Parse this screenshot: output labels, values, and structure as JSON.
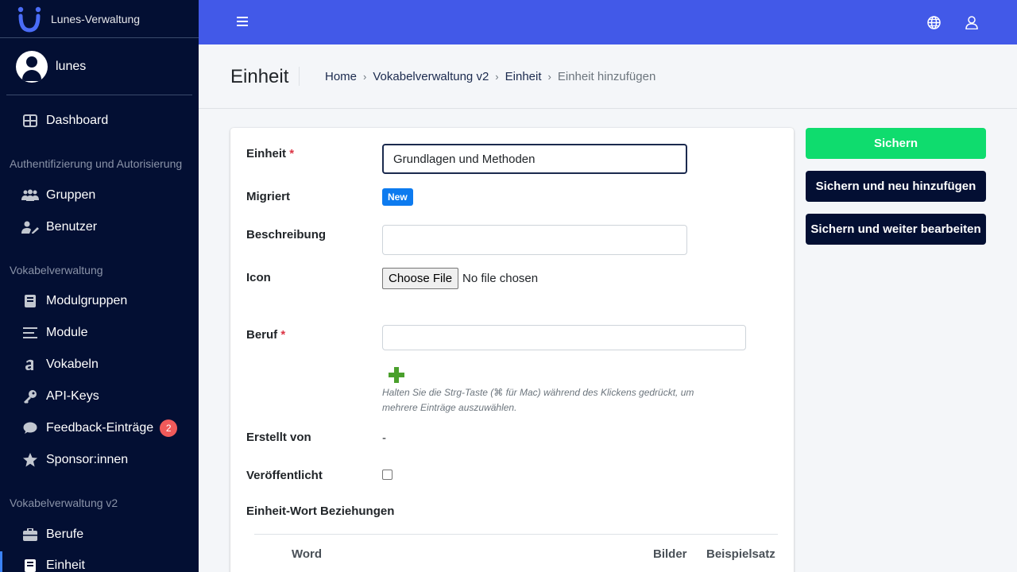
{
  "sidebar": {
    "brand": "Lunes-Verwaltung",
    "user": "lunes",
    "dashboard": "Dashboard",
    "header_auth": "Authentifizierung und Autorisierung",
    "gruppen": "Gruppen",
    "benutzer": "Benutzer",
    "header_vokabel": "Vokabelverwaltung",
    "modulgruppen": "Modulgruppen",
    "module": "Module",
    "vokabeln": "Vokabeln",
    "api_keys": "API-Keys",
    "feedback": "Feedback-Einträge",
    "feedback_count": "2",
    "sponsor": "Sponsor:innen",
    "header_vokabel_v2": "Vokabelverwaltung v2",
    "berufe": "Berufe",
    "einheit": "Einheit"
  },
  "header": {
    "title": "Einheit",
    "breadcrumb": {
      "home": "Home",
      "app": "Vokabelverwaltung v2",
      "model": "Einheit",
      "current": "Einheit hinzufügen",
      "separator": "›"
    }
  },
  "form": {
    "einheit_label": "Einheit",
    "required_mark": "*",
    "einheit_value": "Grundlagen und Methoden",
    "migriert_label": "Migriert",
    "migriert_badge": "New",
    "beschreibung_label": "Beschreibung",
    "beschreibung_value": "",
    "icon_label": "Icon",
    "file_button": "Choose File",
    "file_status": "No file chosen",
    "beruf_label": "Beruf",
    "help_text": "Halten Sie die Strg-Taste (⌘ für Mac) während des Klickens gedrückt, um mehrere Einträge auszuwählen.",
    "erstellt_label": "Erstellt von",
    "erstellt_value": "-",
    "veroeffentlicht_label": "Veröffentlicht",
    "veroeffentlicht_checked": false,
    "relations_title": "Einheit-Wort Beziehungen",
    "columns": {
      "word": "Word",
      "bilder": "Bilder",
      "beispielsatz": "Beispielsatz"
    }
  },
  "actions": {
    "save": "Sichern",
    "save_add": "Sichern und neu hinzufügen",
    "save_continue": "Sichern und weiter bearbeiten"
  },
  "colors": {
    "sidebar_bg": "#030f33",
    "topbar_bg": "#4259e8",
    "save_green": "#0fdc6e",
    "badge_blue": "#0d7bef",
    "badge_red": "#f05a5a"
  }
}
